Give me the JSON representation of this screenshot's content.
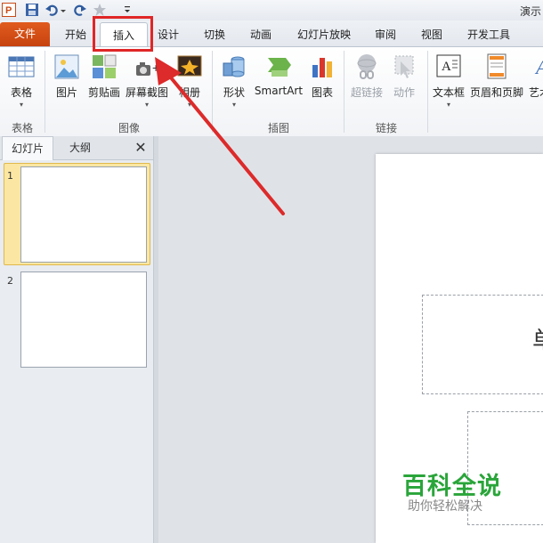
{
  "window": {
    "title": "演示"
  },
  "tabs": [
    {
      "label": "文件"
    },
    {
      "label": "开始"
    },
    {
      "label": "插入"
    },
    {
      "label": "设计"
    },
    {
      "label": "切换"
    },
    {
      "label": "动画"
    },
    {
      "label": "幻灯片放映"
    },
    {
      "label": "审阅"
    },
    {
      "label": "视图"
    },
    {
      "label": "开发工具"
    }
  ],
  "ribbon": {
    "groups": [
      {
        "label": "表格"
      },
      {
        "label": "图像"
      },
      {
        "label": "插图"
      },
      {
        "label": "链接"
      }
    ],
    "buttons": {
      "table": "表格",
      "picture": "图片",
      "clipart": "剪贴画",
      "screenshot": "屏幕截图",
      "album": "相册",
      "shapes": "形状",
      "smartart": "SmartArt",
      "chart": "图表",
      "hyperlink": "超链接",
      "action": "动作",
      "textbox": "文本框",
      "header_footer": "页眉和页脚",
      "wordart": "艺术字"
    }
  },
  "panel": {
    "tab_slides": "幻灯片",
    "tab_outline": "大纲",
    "close": "✕",
    "thumbnails": [
      {
        "num": "1"
      },
      {
        "num": "2"
      }
    ]
  },
  "slide": {
    "title_char": "单"
  },
  "watermark": {
    "main": "百科全说",
    "sub": "助你轻松解决"
  },
  "colors": {
    "file_tab": "#c7430f",
    "highlight": "#e02626",
    "selection": "#fbe7a3",
    "watermark": "#2aa53a"
  }
}
